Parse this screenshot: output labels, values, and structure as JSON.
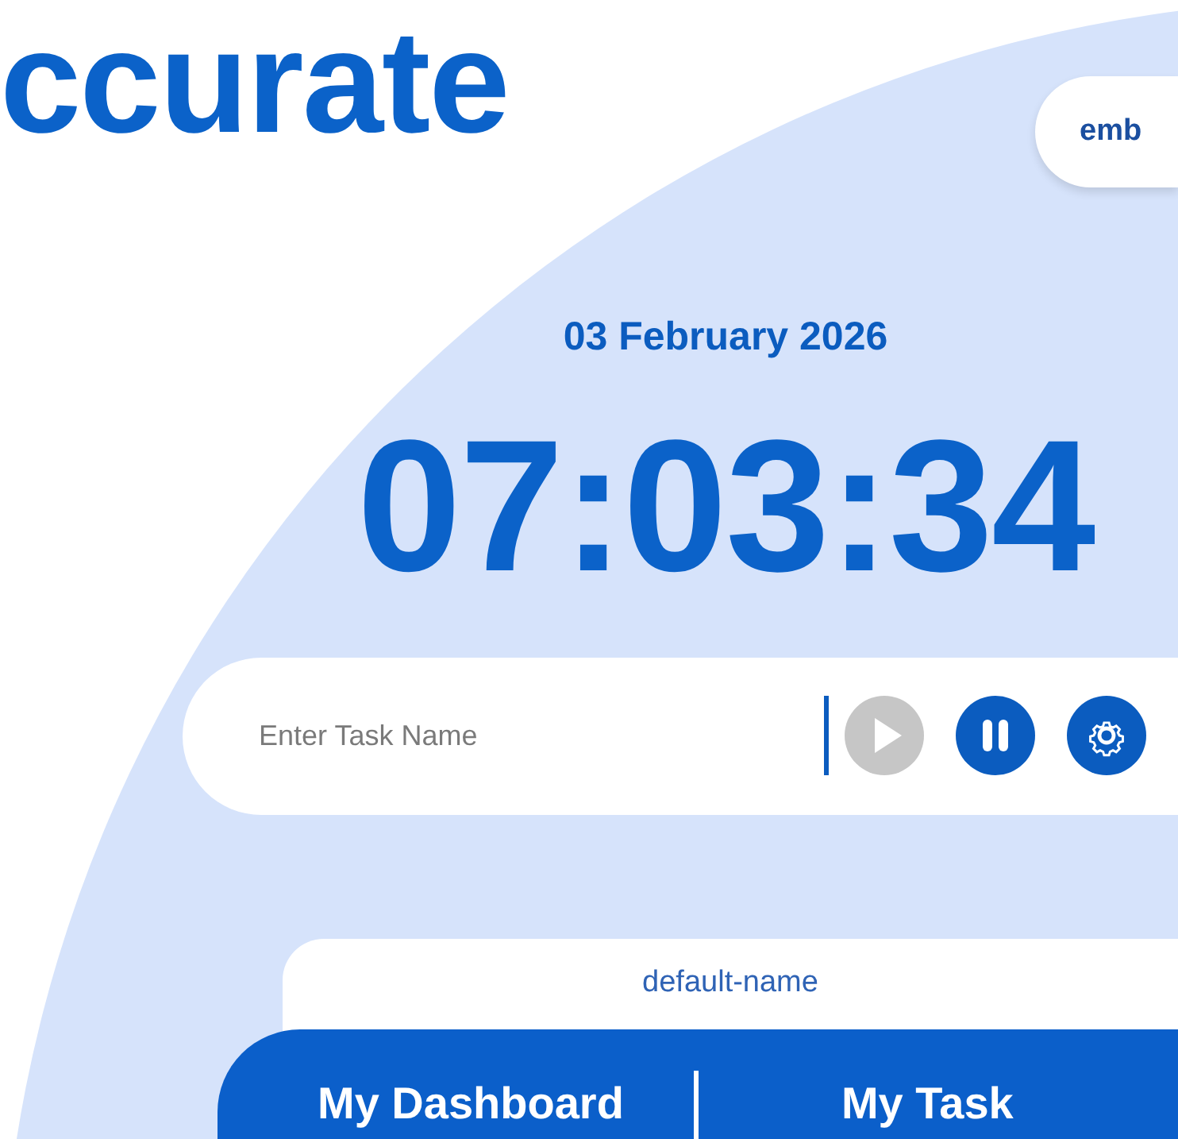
{
  "heading": "ccurate",
  "profile_pill": {
    "label": "emb"
  },
  "date": "03 February 2026",
  "clock": "07:03:34",
  "task_bar": {
    "placeholder": "Enter Task Name",
    "controls": [
      {
        "kind": "play",
        "disabled": true
      },
      {
        "kind": "pause",
        "disabled": false
      },
      {
        "kind": "settings",
        "disabled": false
      }
    ]
  },
  "user_card": {
    "name": "default-name"
  },
  "nav_tabs": [
    {
      "label": "My Dashboard"
    },
    {
      "label": "My Task"
    }
  ]
}
